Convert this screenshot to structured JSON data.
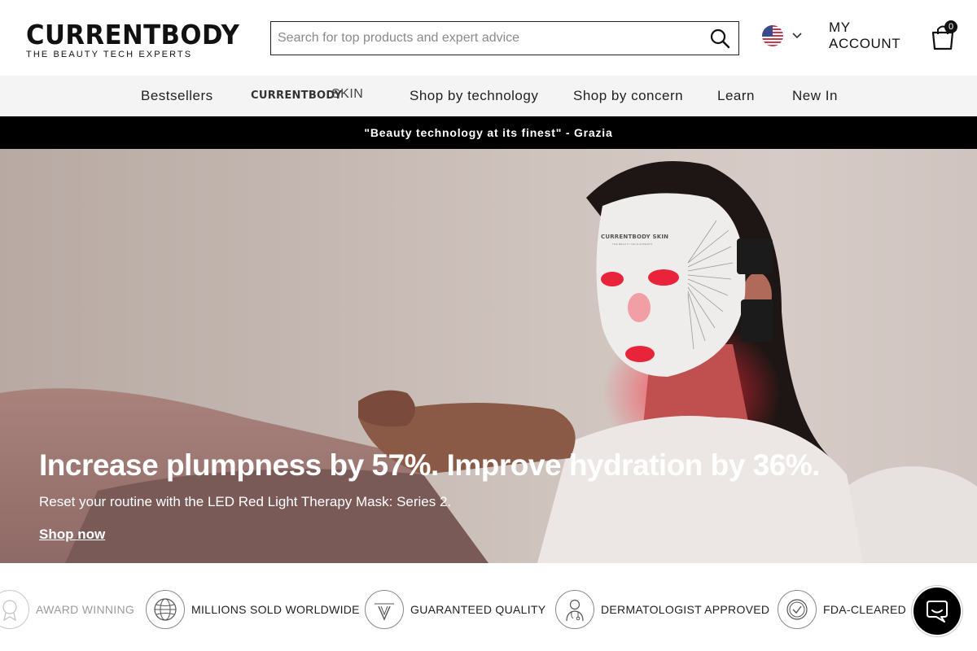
{
  "brand": {
    "name": "CURRENTBODY",
    "tagline": "THE BEAUTY TECH EXPERTS"
  },
  "search": {
    "placeholder": "Search for top products and expert advice",
    "icon": "search-icon"
  },
  "region": {
    "flag": "us-flag-icon"
  },
  "account": {
    "label": "MY ACCOUNT"
  },
  "cart": {
    "count": "0",
    "icon": "shopping-bag-icon"
  },
  "nav": {
    "items": [
      {
        "label": "Bestsellers"
      },
      {
        "label": "CURRENTBODY SKIN"
      },
      {
        "label": "Shop by technology"
      },
      {
        "label": "Shop by concern"
      },
      {
        "label": "Learn"
      },
      {
        "label": "New In"
      }
    ],
    "skin_word": "CURRENTBODY",
    "skin_sub": "SKIN"
  },
  "announcement": {
    "text": "\"Beauty technology at its finest\" - Grazia"
  },
  "hero": {
    "title": "Increase plumpness by 57%. Improve hydration by 36%.",
    "subtitle": "Reset your routine with the LED Red Light Therapy Mask: Series 2.",
    "cta": "Shop now",
    "mask_brand": "CURRENTBODY SKIN",
    "mask_sub": "THE BEAUTY TECH EXPERTS"
  },
  "trust": {
    "items": [
      {
        "label": "AWARD WINNING",
        "icon": "award-icon"
      },
      {
        "label": "MILLIONS SOLD WORLDWIDE",
        "icon": "globe-icon"
      },
      {
        "label": "GUARANTEED QUALITY",
        "icon": "quality-seal-icon"
      },
      {
        "label": "DERMATOLOGIST APPROVED",
        "icon": "dermatologist-icon"
      },
      {
        "label": "FDA-CLEARED",
        "icon": "checkmark-seal-icon"
      }
    ]
  },
  "colors": {
    "black": "#000000",
    "nav_bg": "#f4f4f4",
    "hero_bg": "#c9bcb6",
    "led_red": "#e8233a"
  }
}
